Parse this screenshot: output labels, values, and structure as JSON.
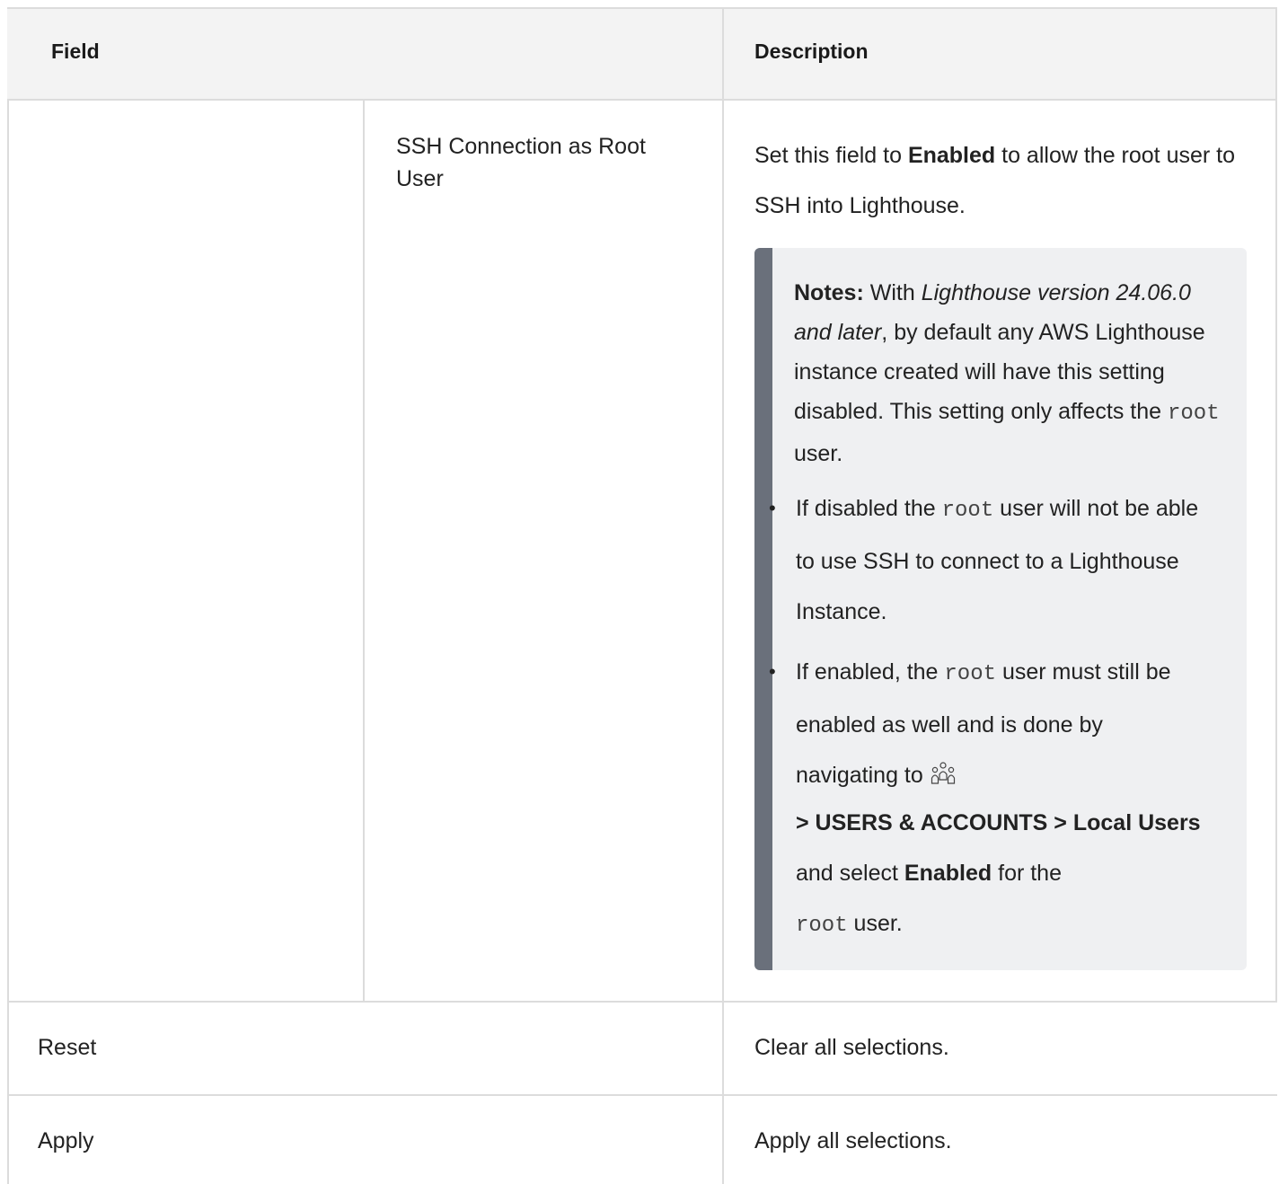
{
  "table": {
    "header": {
      "field": "Field",
      "description": "Description"
    },
    "rows": [
      {
        "field": "",
        "subfield": "SSH Connection as Root User",
        "description": {
          "pre": "Set this field to ",
          "bold": "Enabled",
          "post": " to allow the root user to SSH into Lighthouse."
        },
        "note": {
          "label": "Notes:",
          "t1": " With ",
          "italic": "Lighthouse version 24.06.0 and later",
          "t2": ", by default any AWS Light­house instance created will have this set­ting disabled. This setting only affects the ",
          "code": "root",
          "t3": " user.",
          "bullets": [
            {
              "pre": "If disabled the ",
              "code": "root",
              "post": " user will not be able to use SSH to connect to a Lighthouse Instance."
            },
            {
              "pre": "If enabled, the ",
              "code": "root",
              "post": " user must still be enabled as well and is done by navigating to",
              "icon": "users-icon",
              "path": "> USERS & ACCOUNTS > Local Users",
              "mid": " and select ",
              "bold": "Enabled",
              "end_pre": " for the ",
              "code2": "root",
              "end": " user."
            }
          ]
        }
      },
      {
        "field": "Reset",
        "description": "Clear all selections."
      },
      {
        "field": "Apply",
        "description": "Apply all selections."
      }
    ]
  },
  "colors": {
    "header_bg": "#f3f3f3",
    "note_bg": "#eff0f2",
    "note_bar": "#6a707b",
    "rule": "#dcdcdc"
  }
}
